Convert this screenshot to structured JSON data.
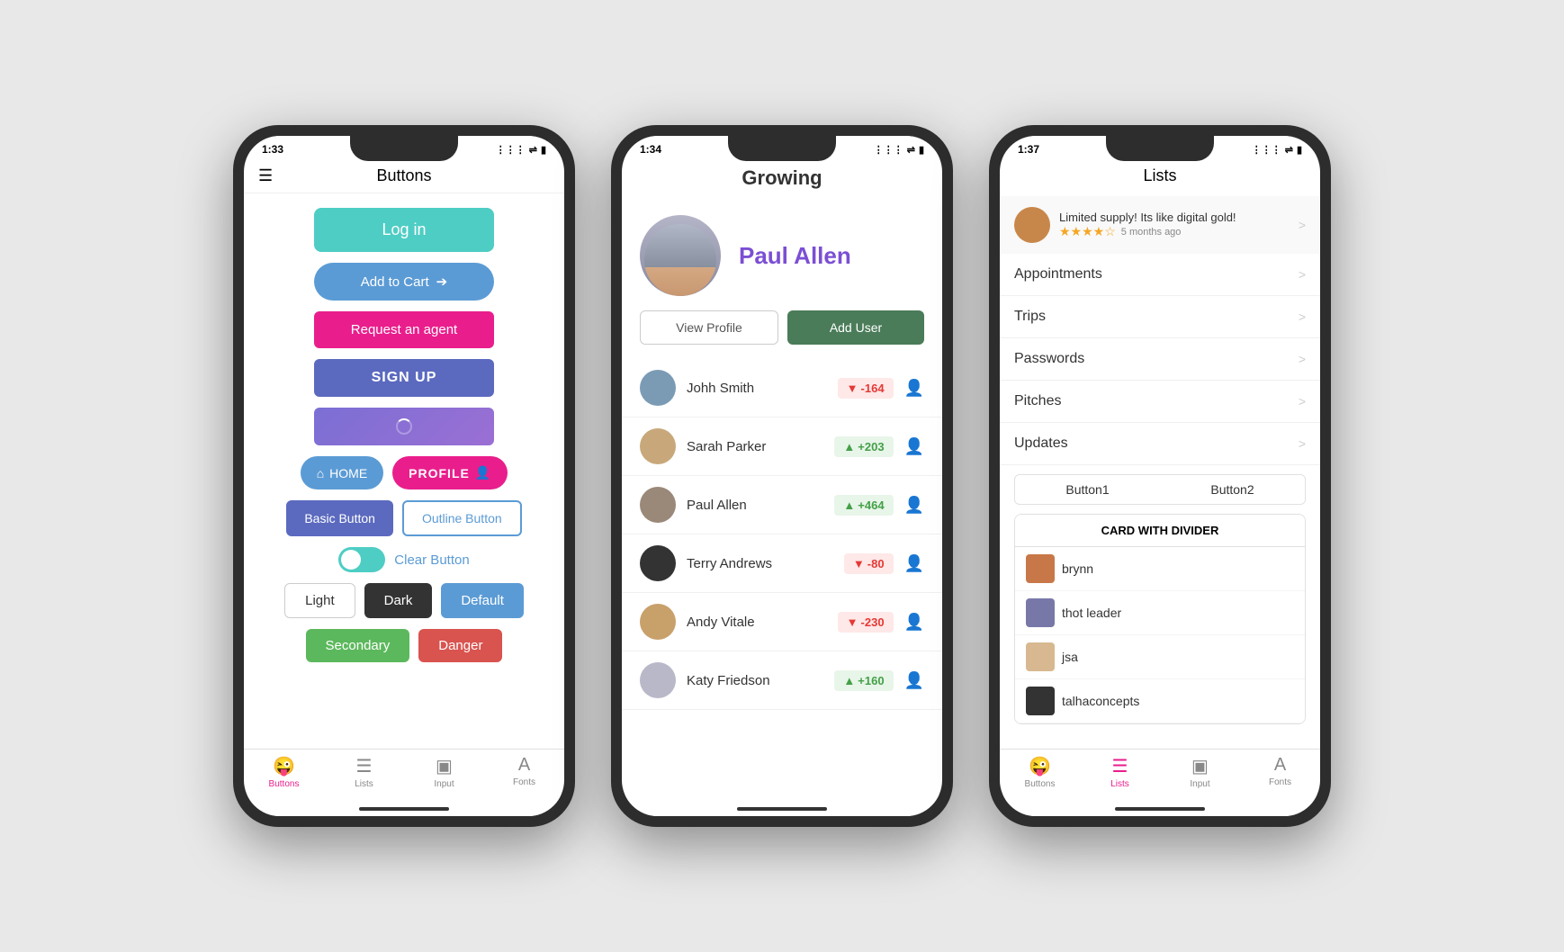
{
  "phone1": {
    "time": "1:33",
    "title": "Buttons",
    "buttons": {
      "login": "Log in",
      "addcart": "Add to Cart",
      "agent": "Request an agent",
      "signup": "SIGN UP",
      "home": "HOME",
      "profile": "PROFILE",
      "basic": "Basic Button",
      "outline": "Outline Button",
      "clear": "Clear Button",
      "light": "Light",
      "dark": "Dark",
      "default": "Default",
      "secondary": "Secondary",
      "danger": "Danger"
    },
    "tabs": [
      "Buttons",
      "Lists",
      "Input",
      "Fonts"
    ]
  },
  "phone2": {
    "time": "1:34",
    "app_title": "Growing",
    "user_name": "Paul Allen",
    "view_profile": "View Profile",
    "add_user": "Add User",
    "list_items": [
      {
        "name": "Johh Smith",
        "score": "-164",
        "type": "negative"
      },
      {
        "name": "Sarah Parker",
        "score": "+203",
        "type": "positive"
      },
      {
        "name": "Paul Allen",
        "score": "+464",
        "type": "positive"
      },
      {
        "name": "Terry Andrews",
        "score": "-80",
        "type": "negative"
      },
      {
        "name": "Andy Vitale",
        "score": "-230",
        "type": "negative"
      },
      {
        "name": "Katy Friedson",
        "score": "+160",
        "type": "positive"
      }
    ]
  },
  "phone3": {
    "time": "1:37",
    "title": "Lists",
    "review_text": "Limited supply! Its like digital gold!",
    "review_time": "5 months ago",
    "review_stars": "★★★★☆",
    "list_rows": [
      "Appointments",
      "Trips",
      "Passwords",
      "Pitches",
      "Updates"
    ],
    "tab1": "Button1",
    "tab2": "Button2",
    "card_title": "CARD WITH DIVIDER",
    "card_items": [
      "brynn",
      "thot leader",
      "jsa",
      "talhaconcepts"
    ],
    "tabs": [
      "Buttons",
      "Lists",
      "Input",
      "Fonts"
    ]
  },
  "avatar_colors": {
    "johh": "#7b9bb5",
    "sarah": "#c8a87a",
    "paul": "#9a8878",
    "terry": "#333333",
    "andy": "#c8a06a",
    "katy": "#b8b8c8",
    "review": "#c8874a",
    "brynn": "#c87848",
    "thot": "#7878a8",
    "jsa": "#d8b890",
    "talha": "#333333"
  }
}
